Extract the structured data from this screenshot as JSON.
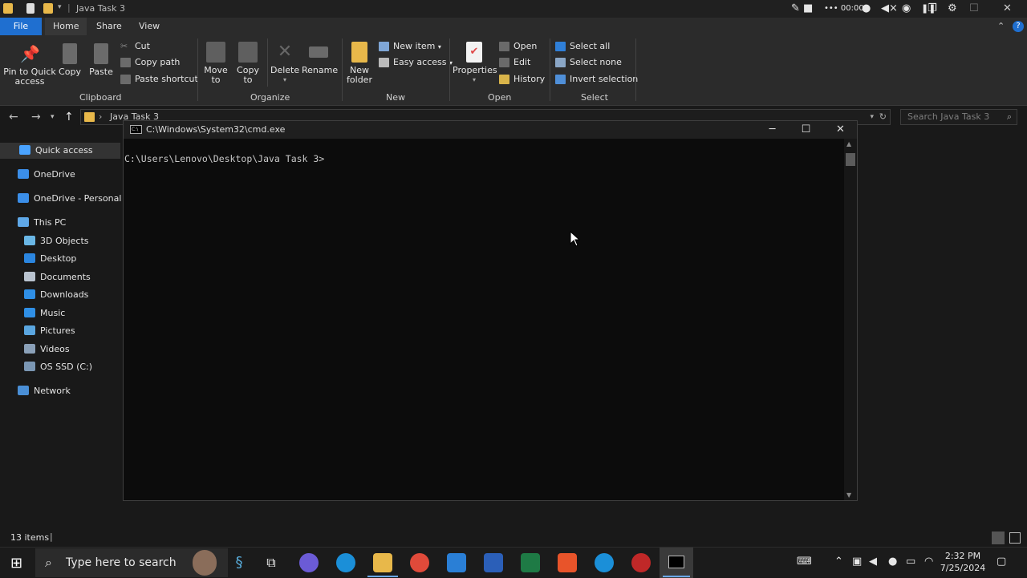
{
  "explorer": {
    "window_title": "Java Task 3",
    "tabs": [
      "File",
      "Home",
      "Share",
      "View"
    ],
    "ribbon": {
      "clipboard": {
        "pin_line1": "Pin to Quick",
        "pin_line2": "access",
        "copy": "Copy",
        "paste": "Paste",
        "cut": "Cut",
        "copy_path": "Copy path",
        "paste_shortcut": "Paste shortcut",
        "group": "Clipboard"
      },
      "organize": {
        "move_line1": "Move",
        "move_line2": "to",
        "copy_line1": "Copy",
        "copy_line2": "to",
        "delete": "Delete",
        "rename": "Rename",
        "group": "Organize"
      },
      "new": {
        "folder_line1": "New",
        "folder_line2": "folder",
        "new_item": "New item",
        "easy_access": "Easy access",
        "group": "New"
      },
      "open": {
        "properties": "Properties",
        "open": "Open",
        "edit": "Edit",
        "history": "History",
        "group": "Open"
      },
      "select": {
        "select_all": "Select all",
        "select_none": "Select none",
        "invert": "Invert selection",
        "group": "Select"
      }
    },
    "address": "Java Task 3",
    "search_placeholder": "Search Java Task 3",
    "nav": [
      {
        "label": "Quick access",
        "icon": "star-icon",
        "color": "#4aa3ff"
      },
      {
        "label": "OneDrive",
        "icon": "cloud-icon",
        "color": "#3b8ee8"
      },
      {
        "label": "OneDrive - Personal",
        "icon": "cloud-icon",
        "color": "#3b8ee8"
      },
      {
        "label": "This PC",
        "icon": "computer-icon",
        "color": "#5fa8e8"
      },
      {
        "label": "3D Objects",
        "icon": "cube-icon",
        "color": "#6ab7e6"
      },
      {
        "label": "Desktop",
        "icon": "desktop-icon",
        "color": "#2b86e0"
      },
      {
        "label": "Documents",
        "icon": "document-icon",
        "color": "#b9c3cf"
      },
      {
        "label": "Downloads",
        "icon": "download-icon",
        "color": "#2f8fe6"
      },
      {
        "label": "Music",
        "icon": "music-icon",
        "color": "#2f8fe6"
      },
      {
        "label": "Pictures",
        "icon": "picture-icon",
        "color": "#5aa6e0"
      },
      {
        "label": "Videos",
        "icon": "video-icon",
        "color": "#8aa0b8"
      },
      {
        "label": "OS SSD (C:)",
        "icon": "drive-icon",
        "color": "#7b97b4"
      },
      {
        "label": "Network",
        "icon": "network-icon",
        "color": "#4a8fd6"
      }
    ],
    "status_items": "13 items"
  },
  "cmd": {
    "title": "C:\\Windows\\System32\\cmd.exe",
    "prompt": "C:\\Users\\Lenovo\\Desktop\\Java Task 3>",
    "minimize": "─",
    "maximize": "☐",
    "close": "✕"
  },
  "taskbar": {
    "search_placeholder": "Type here to search",
    "time": "2:32 PM",
    "date": "7/25/2024"
  },
  "colors": {
    "accent": "#1f6fd0",
    "background": "#191919",
    "cmd_bg": "#0c0c0c"
  }
}
